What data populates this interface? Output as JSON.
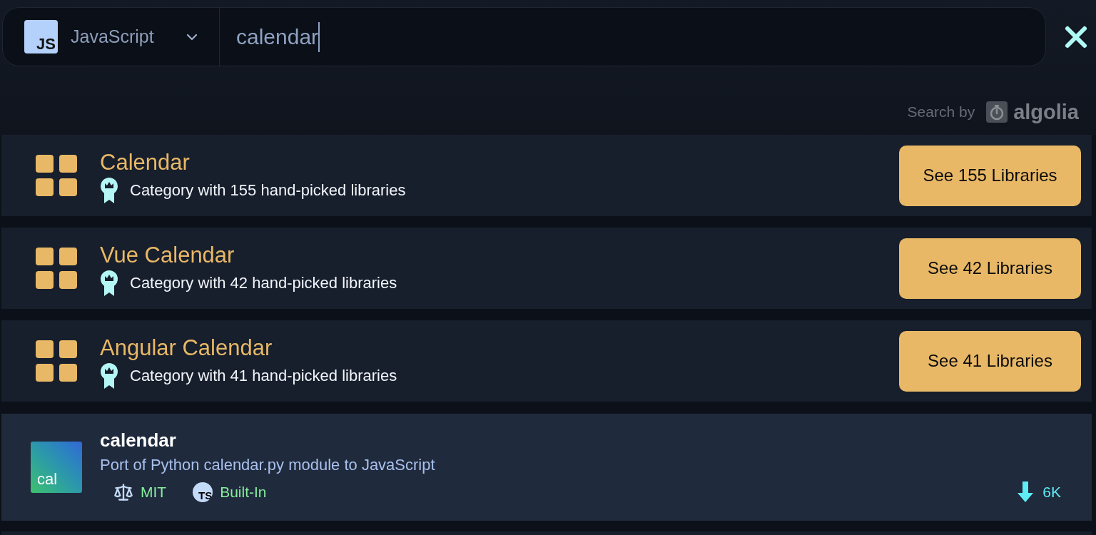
{
  "language_selector": {
    "logo_text": "JS",
    "label": "JavaScript"
  },
  "search": {
    "value": "calendar",
    "focused": true
  },
  "attribution": {
    "label": "Search by",
    "brand": "algolia"
  },
  "categories": [
    {
      "title": "Calendar",
      "description": "Category with 155 hand-picked libraries",
      "button": "See 155 Libraries"
    },
    {
      "title": "Vue Calendar",
      "description": "Category with 42 hand-picked libraries",
      "button": "See 42 Libraries"
    },
    {
      "title": "Angular Calendar",
      "description": "Category with 41 hand-picked libraries",
      "button": "See 41 Libraries"
    }
  ],
  "libraries": [
    {
      "logo_text": "cal",
      "name": "calendar",
      "description": "Port of Python calendar.py module to JavaScript",
      "license": "MIT",
      "types_icon_text": "TS",
      "types": "Built-In",
      "downloads": "6K"
    }
  ]
}
